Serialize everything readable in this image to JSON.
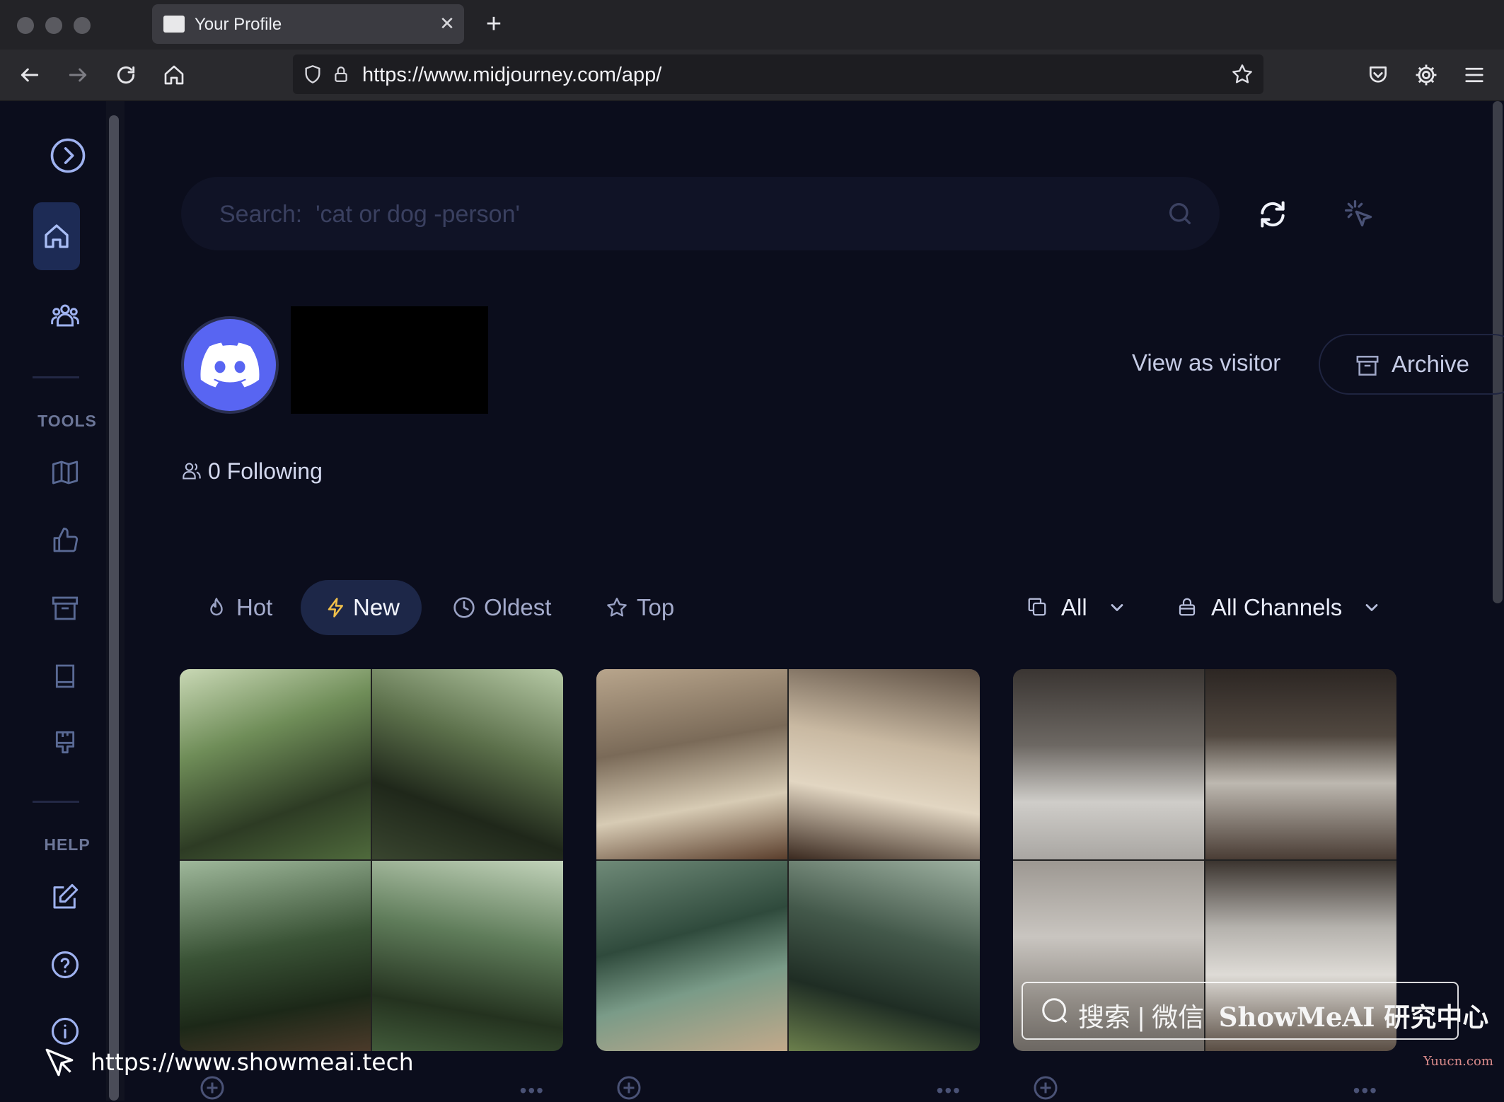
{
  "browser": {
    "tab_title": "Your Profile",
    "url": "https://www.midjourney.com/app/"
  },
  "search": {
    "placeholder": "Search:  'cat or dog -person'"
  },
  "sidebar": {
    "tools_heading": "TOOLS",
    "help_heading": "HELP"
  },
  "profile": {
    "view_as_visitor": "View as visitor",
    "archive": "Archive",
    "following": "0 Following"
  },
  "sort_tabs": [
    {
      "label": "Hot",
      "active": false
    },
    {
      "label": "New",
      "active": true
    },
    {
      "label": "Oldest",
      "active": false
    },
    {
      "label": "Top",
      "active": false
    }
  ],
  "filters": {
    "type": "All",
    "channels": "All Channels"
  },
  "watermark": {
    "search_text": "搜索 | 微信",
    "brand": "ShowMeAI 研究中心",
    "url": "https://www.showmeai.tech",
    "small": "Yuucn.com"
  },
  "colors": {
    "accent": "#5865f2",
    "background": "#0b0d1c",
    "active_tab": "#1d2748"
  }
}
